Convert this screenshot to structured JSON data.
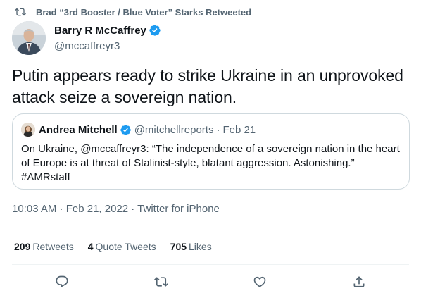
{
  "retweet": {
    "text": "Brad “3rd Booster / Blue Voter” Starks Retweeted"
  },
  "author": {
    "name": "Barry R McCaffrey",
    "handle": "@mccaffreyr3"
  },
  "tweet": {
    "text": "Putin appears ready to strike Ukraine in an unprovoked attack seize a sovereign nation."
  },
  "quote": {
    "name": "Andrea Mitchell",
    "handle": "@mitchellreports",
    "separator": "·",
    "date": "Feb 21",
    "body": "On Ukraine, @mccaffreyr3: “The independence of a sovereign nation in the heart of Europe is at threat of Stalinist-style, blatant aggression. Astonishing.” #AMRstaff"
  },
  "meta": {
    "timestamp": "10:03 AM · Feb 21, 2022 · Twitter for iPhone"
  },
  "stats": {
    "retweets_count": "209",
    "retweets_label": "Retweets",
    "quotes_count": "4",
    "quotes_label": "Quote Tweets",
    "likes_count": "705",
    "likes_label": "Likes"
  },
  "actions": [
    "reply-icon",
    "retweet-icon",
    "like-icon",
    "share-icon"
  ],
  "colors": {
    "verified": "#1d9bf0",
    "secondary_text": "#536471",
    "primary_text": "#0f1419",
    "border": "#cfd9de"
  }
}
